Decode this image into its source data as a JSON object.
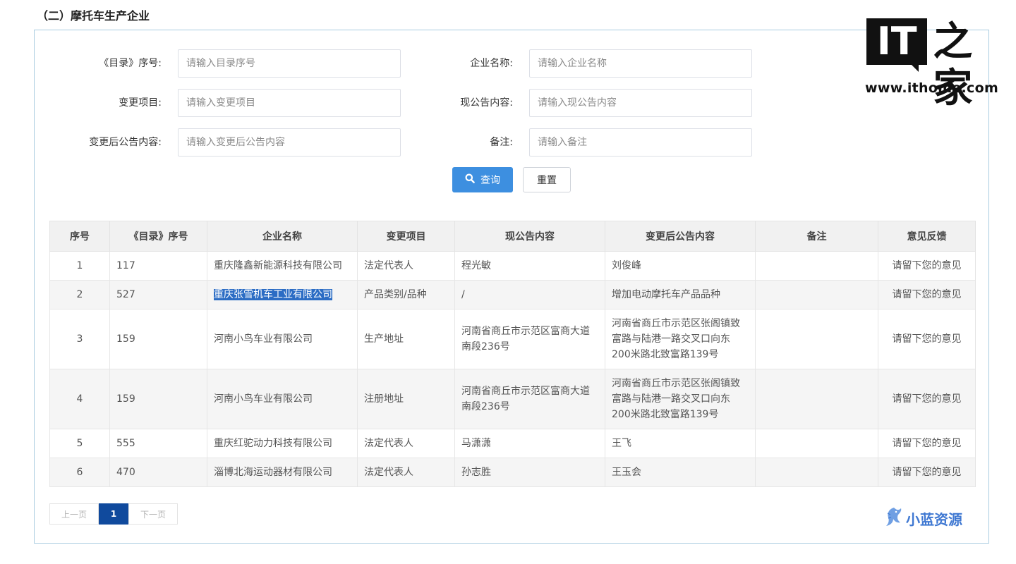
{
  "section_title": "（二）摩托车生产企业",
  "form": {
    "catalog_no": {
      "label": "《目录》序号:",
      "placeholder": "请输入目录序号"
    },
    "company": {
      "label": "企业名称:",
      "placeholder": "请输入企业名称"
    },
    "change_item": {
      "label": "变更项目:",
      "placeholder": "请输入变更项目"
    },
    "current_notice": {
      "label": "现公告内容:",
      "placeholder": "请输入现公告内容"
    },
    "new_notice": {
      "label": "变更后公告内容:",
      "placeholder": "请输入变更后公告内容"
    },
    "remark": {
      "label": "备注:",
      "placeholder": "请输入备注"
    },
    "query_label": "查询",
    "reset_label": "重置"
  },
  "table": {
    "headers": [
      "序号",
      "《目录》序号",
      "企业名称",
      "变更项目",
      "现公告内容",
      "变更后公告内容",
      "备注",
      "意见反馈"
    ],
    "rows": [
      {
        "no": "1",
        "catalog": "117",
        "company": "重庆隆鑫新能源科技有限公司",
        "item": "法定代表人",
        "current": "程光敏",
        "new": "刘俊峰",
        "remark": "",
        "feedback": "请留下您的意见"
      },
      {
        "no": "2",
        "catalog": "527",
        "company": "重庆张雪机车工业有限公司",
        "item": "产品类别/品种",
        "current": "/",
        "new": "增加电动摩托车产品品种",
        "remark": "",
        "feedback": "请留下您的意见"
      },
      {
        "no": "3",
        "catalog": "159",
        "company": "河南小鸟车业有限公司",
        "item": "生产地址",
        "current": "河南省商丘市示范区富商大道南段236号",
        "new": "河南省商丘市示范区张阁镇致富路与陆港一路交叉口向东200米路北致富路139号",
        "remark": "",
        "feedback": "请留下您的意见"
      },
      {
        "no": "4",
        "catalog": "159",
        "company": "河南小鸟车业有限公司",
        "item": "注册地址",
        "current": "河南省商丘市示范区富商大道南段236号",
        "new": "河南省商丘市示范区张阁镇致富路与陆港一路交叉口向东200米路北致富路139号",
        "remark": "",
        "feedback": "请留下您的意见"
      },
      {
        "no": "5",
        "catalog": "555",
        "company": "重庆红驼动力科技有限公司",
        "item": "法定代表人",
        "current": "马潇潇",
        "new": "王飞",
        "remark": "",
        "feedback": "请留下您的意见"
      },
      {
        "no": "6",
        "catalog": "470",
        "company": "淄博北海运动器材有限公司",
        "item": "法定代表人",
        "current": "孙志胜",
        "new": "王玉会",
        "remark": "",
        "feedback": "请留下您的意见"
      }
    ]
  },
  "pagination": {
    "prev": "上一页",
    "current": "1",
    "next": "下一页"
  },
  "logo": {
    "it": "IT",
    "zh": "之家",
    "url": "www.ithome.com"
  },
  "watermark": {
    "text": "小蓝资源"
  },
  "colors": {
    "primary": "#3d8fe0",
    "pager_active": "#104a9d",
    "highlight": "#2b6cc4",
    "watermark": "#3f78d2"
  },
  "icons": {
    "query": "search-icon",
    "watermark": "dragon-icon"
  }
}
